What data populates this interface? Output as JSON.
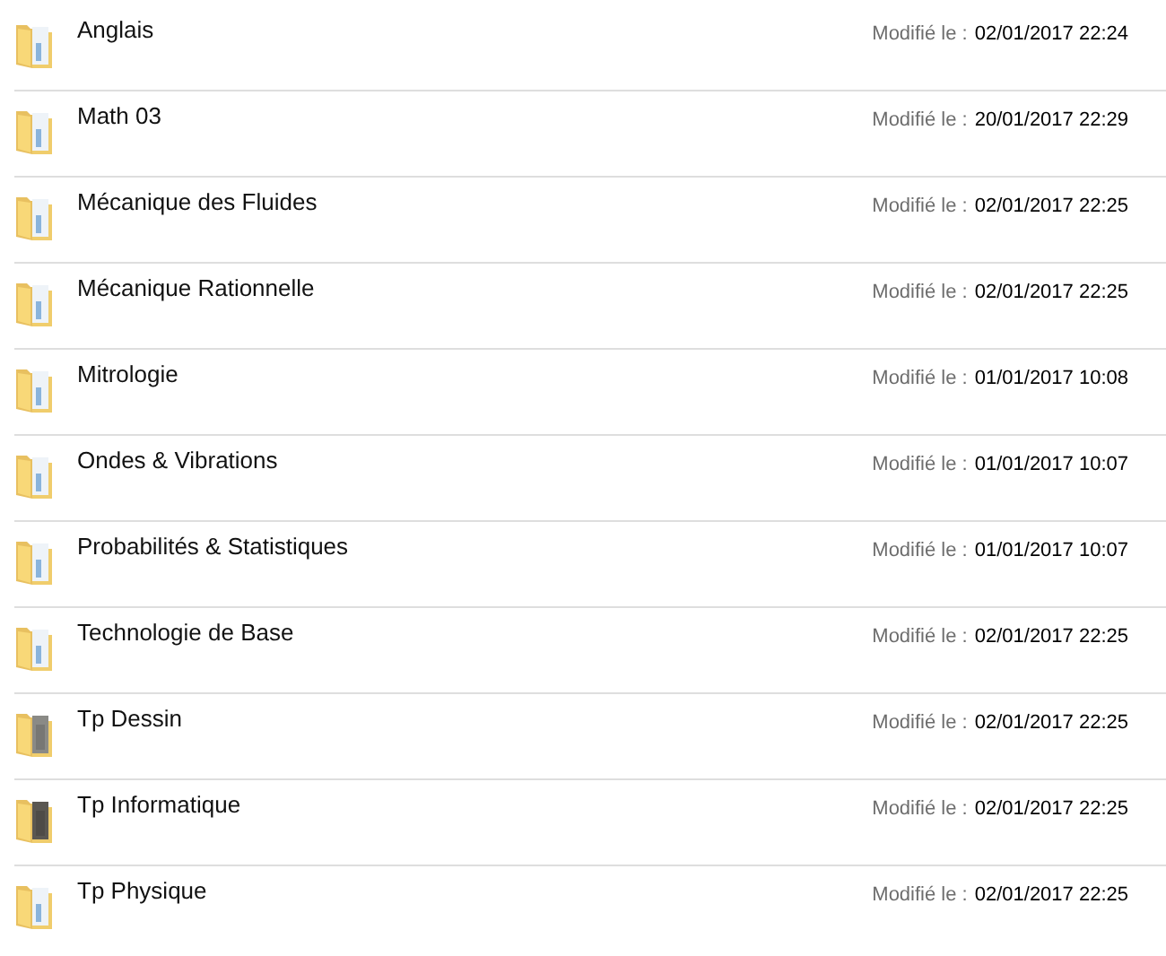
{
  "folders": [
    {
      "name": "Anglais",
      "kind": "papers",
      "modified_label": "Modifié le :",
      "modified": "02/01/2017 22:24"
    },
    {
      "name": "Math 03",
      "kind": "papers",
      "modified_label": "Modifié le :",
      "modified": "20/01/2017 22:29"
    },
    {
      "name": "Mécanique des Fluides",
      "kind": "papers",
      "modified_label": "Modifié le :",
      "modified": "02/01/2017 22:25"
    },
    {
      "name": "Mécanique Rationnelle",
      "kind": "papers",
      "modified_label": "Modifié le :",
      "modified": "02/01/2017 22:25"
    },
    {
      "name": "Mitrologie",
      "kind": "papers",
      "modified_label": "Modifié le :",
      "modified": "01/01/2017 10:08"
    },
    {
      "name": "Ondes & Vibrations",
      "kind": "papers",
      "modified_label": "Modifié le :",
      "modified": "01/01/2017 10:07"
    },
    {
      "name": "Probabilités & Statistiques",
      "kind": "papers",
      "modified_label": "Modifié le :",
      "modified": "01/01/2017 10:07"
    },
    {
      "name": "Technologie de Base",
      "kind": "papers",
      "modified_label": "Modifié le :",
      "modified": "02/01/2017 22:25"
    },
    {
      "name": "Tp Dessin",
      "kind": "grey",
      "modified_label": "Modifié le :",
      "modified": "02/01/2017 22:25"
    },
    {
      "name": "Tp Informatique",
      "kind": "dark",
      "modified_label": "Modifié le :",
      "modified": "02/01/2017 22:25"
    },
    {
      "name": "Tp Physique",
      "kind": "papers",
      "modified_label": "Modifié le :",
      "modified": "02/01/2017 22:25"
    }
  ]
}
